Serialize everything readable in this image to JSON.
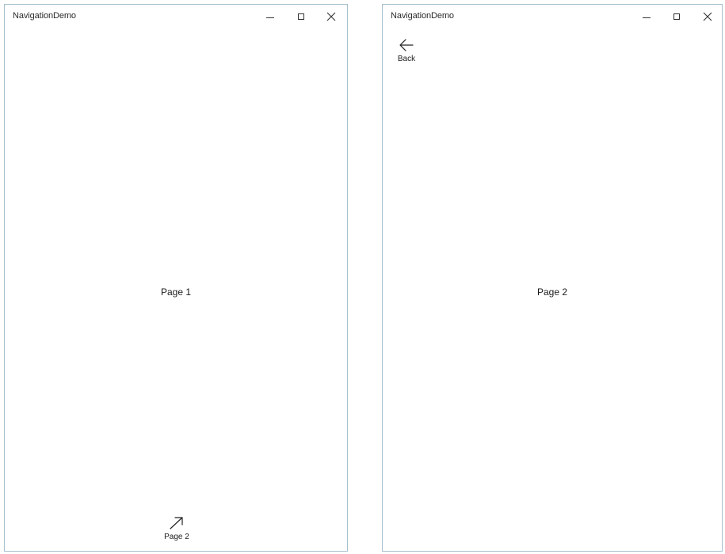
{
  "windows": [
    {
      "title": "NavigationDemo",
      "content_text": "Page 1",
      "nav_button": {
        "label": "Page 2",
        "icon": "forward-arrow-icon"
      }
    },
    {
      "title": "NavigationDemo",
      "content_text": "Page 2",
      "nav_button": {
        "label": "Back",
        "icon": "back-arrow-icon"
      }
    }
  ]
}
